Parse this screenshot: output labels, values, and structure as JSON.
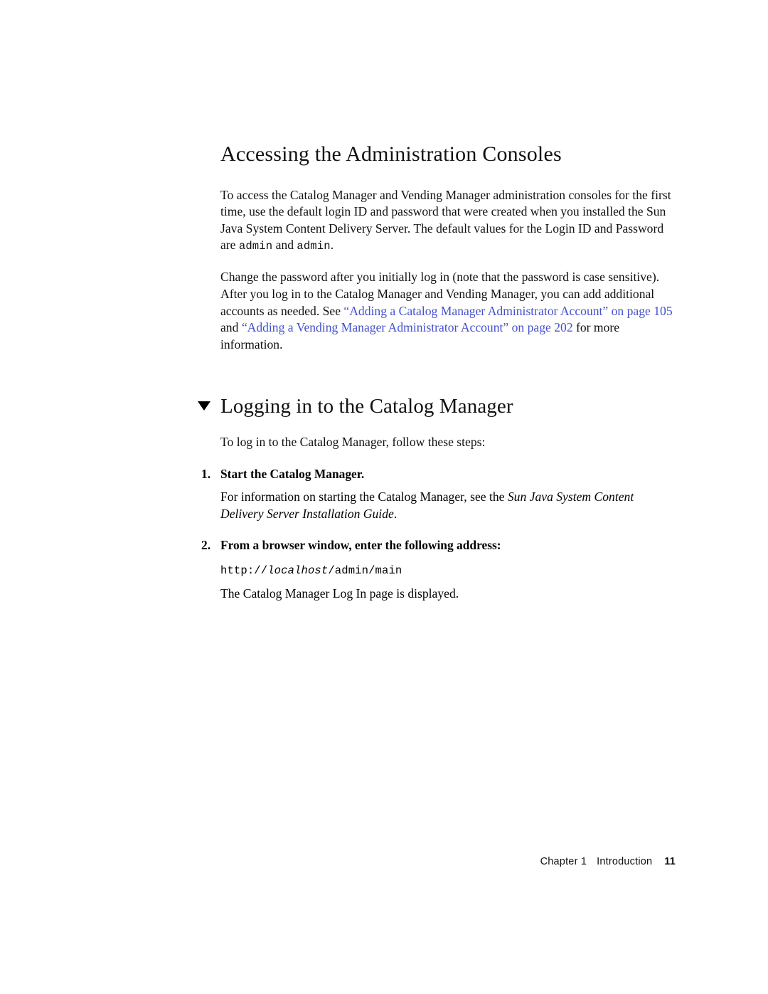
{
  "document": {
    "section_title": "Accessing the Administration Consoles",
    "intro_paragraphs": {
      "p1_part1": "To access the Catalog Manager and Vending Manager administration consoles for the first time, use the default login ID and password that were created when you installed the Sun Java System Content Delivery Server. The default values for the Login ID and Password are ",
      "p1_code1": "admin",
      "p1_part2": " and ",
      "p1_code2": "admin",
      "p1_part3": ".",
      "p2_part1": "Change the password after you initially log in (note that the password is case sensitive). After you log in to the Catalog Manager and Vending Manager, you can add additional accounts as needed. See ",
      "p2_link1": "“Adding a Catalog Manager Administrator Account” on page 105",
      "p2_part2": " and ",
      "p2_link2": "“Adding a Vending Manager Administrator Account” on page 202",
      "p2_part3": " for more information."
    },
    "chapter_section": {
      "marker_icon": "triangle-down-icon",
      "heading": "Logging in to the Catalog Manager",
      "lead_in": "To log in to the Catalog Manager, follow these steps:"
    },
    "steps": [
      {
        "number": "1.",
        "title": "Start the Catalog Manager.",
        "body_part1": "For information on starting the Catalog Manager, see the ",
        "body_italic": "Sun Java System Content Delivery Server Installation Guide",
        "body_part2": "."
      },
      {
        "number": "2.",
        "title": "From a browser window, enter the following address:",
        "url_prefix": "http://",
        "url_host": "localhost",
        "url_path": "/admin/main",
        "body_after": "The Catalog Manager Log In page is displayed."
      }
    ],
    "footer": {
      "chapter": "Chapter 1",
      "section": "Introduction",
      "page_number": "11"
    },
    "colors": {
      "link": "#4350cc",
      "text": "#111111",
      "background": "#ffffff"
    }
  }
}
